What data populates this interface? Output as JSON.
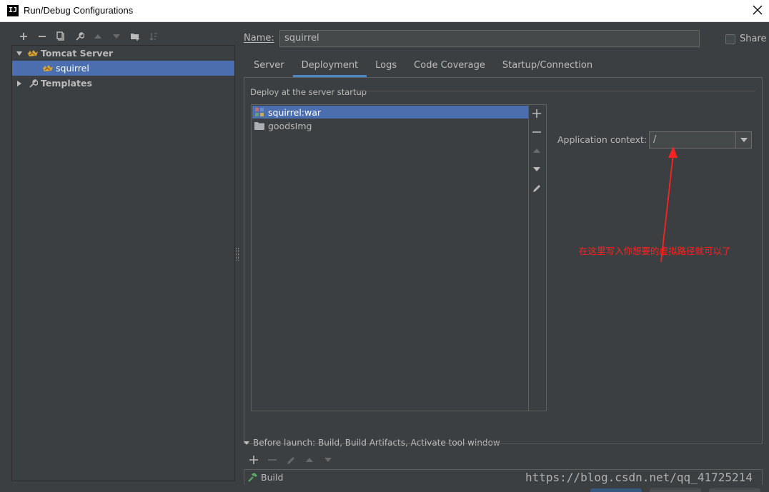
{
  "window": {
    "title": "Run/Debug Configurations",
    "app_icon_text": "IJ"
  },
  "toolbar": {
    "buttons": [
      {
        "icon": "plus-icon",
        "enabled": true
      },
      {
        "icon": "minus-icon",
        "enabled": true
      },
      {
        "icon": "copy-icon",
        "enabled": true
      },
      {
        "icon": "wrench-icon",
        "enabled": true
      },
      {
        "icon": "arrow-up-icon",
        "enabled": false
      },
      {
        "icon": "arrow-down-icon",
        "enabled": false
      },
      {
        "icon": "new-folder-icon",
        "enabled": true
      },
      {
        "icon": "sort-icon",
        "enabled": false
      }
    ]
  },
  "tree": {
    "groups": [
      {
        "label": "Tomcat Server",
        "expanded": true,
        "children": [
          {
            "label": "squirrel",
            "selected": true
          }
        ]
      },
      {
        "label": "Templates",
        "expanded": false
      }
    ]
  },
  "name_field": {
    "label": "Name:",
    "value": "squirrel"
  },
  "share": {
    "label": "Share",
    "checked": false
  },
  "tabs": [
    {
      "label": "Server",
      "active": false
    },
    {
      "label": "Deployment",
      "active": true
    },
    {
      "label": "Logs",
      "active": false
    },
    {
      "label": "Code Coverage",
      "active": false
    },
    {
      "label": "Startup/Connection",
      "active": false
    }
  ],
  "deployment": {
    "section_title": "Deploy at the server startup",
    "artifacts": [
      {
        "label": "squirrel:war",
        "icon": "war-artifact-icon",
        "selected": true
      },
      {
        "label": "goodsImg",
        "icon": "folder-icon",
        "selected": false
      }
    ],
    "context_label": "Application context:",
    "context_value": "/"
  },
  "annotation": "在这里写入你想要的虚拟路径就可以了",
  "before_launch": {
    "label": "Before launch: Build, Build Artifacts, Activate tool window",
    "items": [
      {
        "label": "Build",
        "icon": "hammer-icon"
      }
    ]
  },
  "watermark": "https://blog.csdn.net/qq_41725214",
  "colors": {
    "background": "#3c3f41",
    "selection": "#4b6eaf",
    "annotation": "#ff2222",
    "tab_underline": "#4a88c7"
  }
}
